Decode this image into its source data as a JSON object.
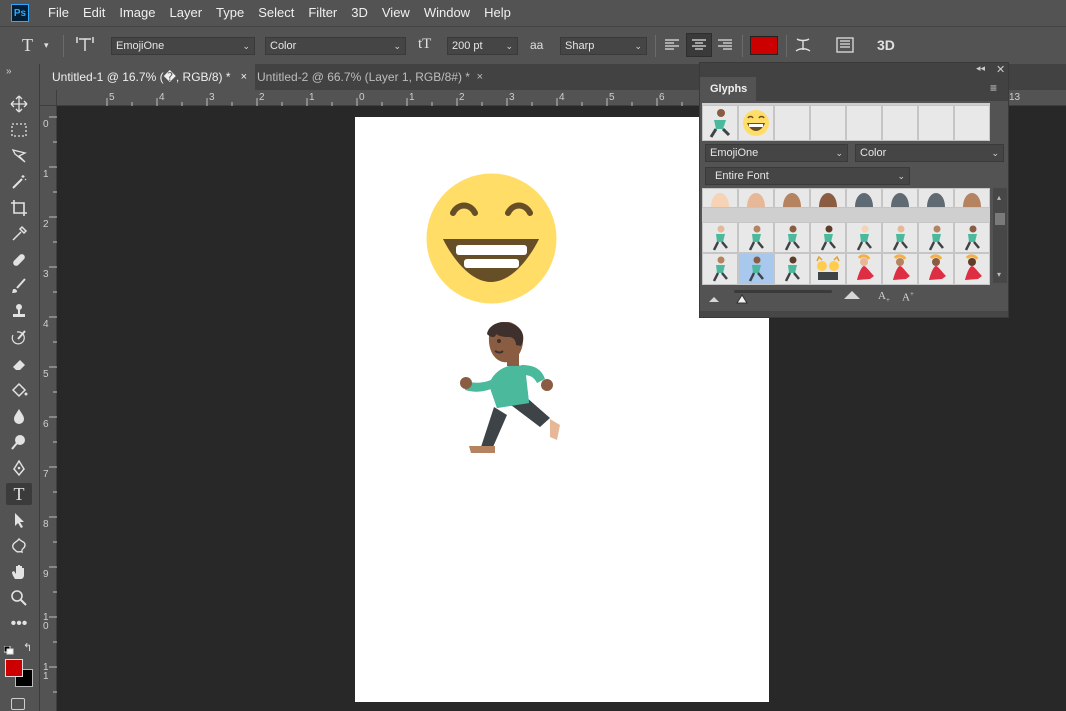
{
  "app": {
    "logo": "Ps"
  },
  "menu": [
    "File",
    "Edit",
    "Image",
    "Layer",
    "Type",
    "Select",
    "Filter",
    "3D",
    "View",
    "Window",
    "Help"
  ],
  "options": {
    "font_family": "EmojiOne",
    "font_style": "Color",
    "font_size": "200 pt",
    "anti_alias_label": "aa",
    "anti_alias": "Sharp",
    "text_color": "#cc0000",
    "three_d": "3D"
  },
  "tabs": [
    {
      "label": "Untitled-1 @ 16.7% (�, RGB/8) *",
      "close": "×",
      "active": true
    },
    {
      "label": "Untitled-2 @ 66.7% (Layer 1, RGB/8#) *",
      "close": "×",
      "active": false
    }
  ],
  "ruler_h": [
    "5",
    "4",
    "3",
    "2",
    "1",
    "0",
    "1",
    "2",
    "3",
    "4",
    "5",
    "6",
    "13"
  ],
  "ruler_v": [
    "0",
    "1",
    "2",
    "3",
    "4",
    "5",
    "6",
    "7",
    "8",
    "9",
    "1\n0",
    "1\n1"
  ],
  "toolbar": {
    "fg_color": "#cc0000",
    "bg_color": "#000000"
  },
  "glyphs_panel": {
    "title": "Glyphs",
    "recent": [
      "runner",
      "grin"
    ],
    "font": "EmojiOne",
    "style": "Color",
    "filter": "Entire Font"
  }
}
